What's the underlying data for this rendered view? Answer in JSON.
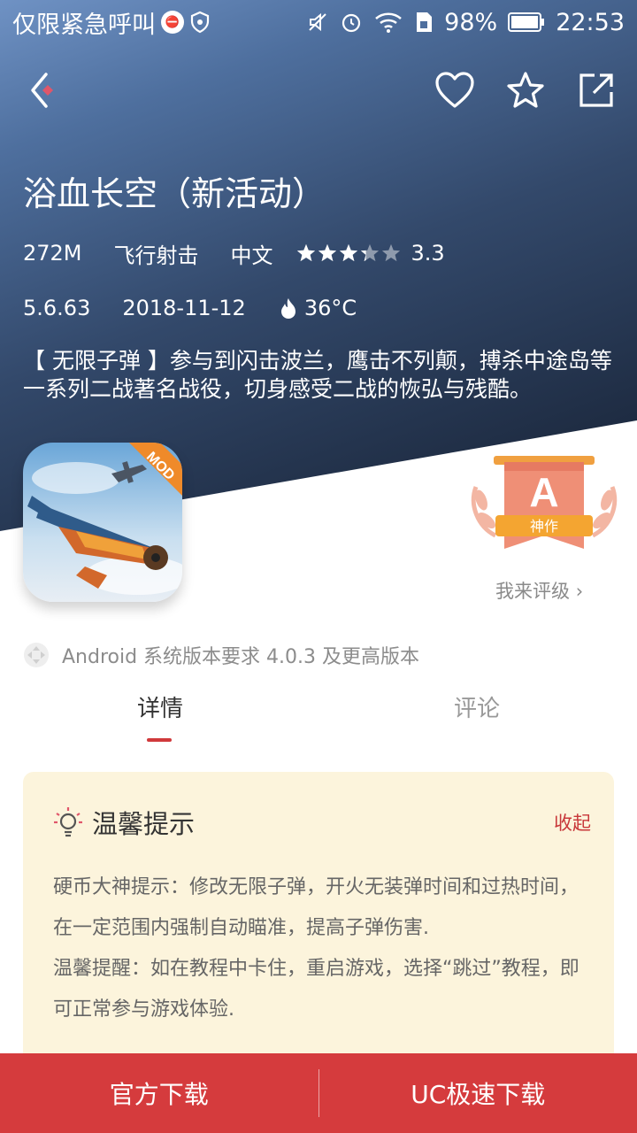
{
  "status_bar": {
    "carrier": "仅限紧急呼叫",
    "battery": "98%",
    "time": "22:53"
  },
  "nav": {
    "back_icon": "back-arrow-icon",
    "like_icon": "heart-icon",
    "favorite_icon": "star-icon",
    "share_icon": "share-icon"
  },
  "app": {
    "title": "浴血长空（新活动）",
    "size": "272M",
    "category": "飞行射击",
    "language": "中文",
    "rating": "3.3",
    "rating_value": 3.3,
    "version": "5.6.63",
    "date": "2018-11-12",
    "temperature": "36°C",
    "description": "【 无限子弹 】参与到闪击波兰，鹰击不列颠，搏杀中途岛等一系列二战著名战役，切身感受二战的恢弘与残酷。",
    "icon_tag": "MOD"
  },
  "badge": {
    "grade": "A",
    "label": "神作",
    "rate_link": "我来评级"
  },
  "requirement": "Android 系统版本要求 4.0.3 及更高版本",
  "tabs": {
    "detail": "详情",
    "comment": "评论"
  },
  "tips": {
    "title": "温馨提示",
    "collapse": "收起",
    "line1": "硬币大神提示：修改无限子弹，开火无装弹时间和过热时间，在一定范围内强制自动瞄准，提高子弹伤害.",
    "line2": "温馨提醒：如在教程中卡住，重启游戏，选择“跳过”教程，即可正常参与游戏体验."
  },
  "download": {
    "official": "官方下载",
    "uc": "UC极速下载"
  },
  "colors": {
    "accent": "#d53b3d",
    "tips_bg": "#fcf4dc",
    "badge": "#f08a6e"
  }
}
